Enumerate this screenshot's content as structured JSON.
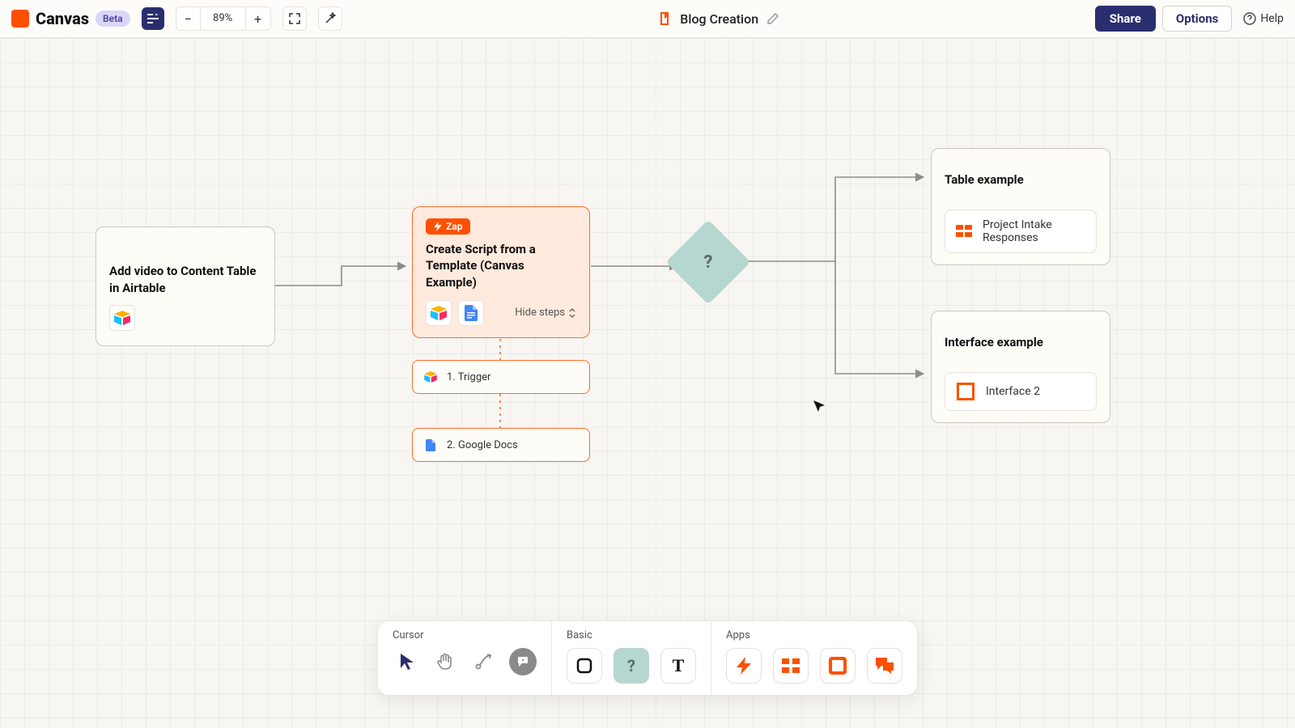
{
  "header": {
    "brand": "Canvas",
    "beta": "Beta",
    "zoom": "89%",
    "doc_title": "Blog Creation",
    "share": "Share",
    "options": "Options",
    "help": "Help"
  },
  "nodes": {
    "left": {
      "title": "Add video to Content Table in Airtable"
    },
    "zap": {
      "badge": "Zap",
      "title": "Create Script from a Template (Canvas Example)",
      "hide": "Hide steps"
    },
    "step1": "1. Trigger",
    "step2": "2. Google Docs",
    "diamond": "?",
    "table": {
      "title": "Table example",
      "item": "Project Intake Responses"
    },
    "interface": {
      "title": "Interface example",
      "item": "Interface 2"
    }
  },
  "toolbar": {
    "cursor": "Cursor",
    "basic": "Basic",
    "apps": "Apps"
  }
}
